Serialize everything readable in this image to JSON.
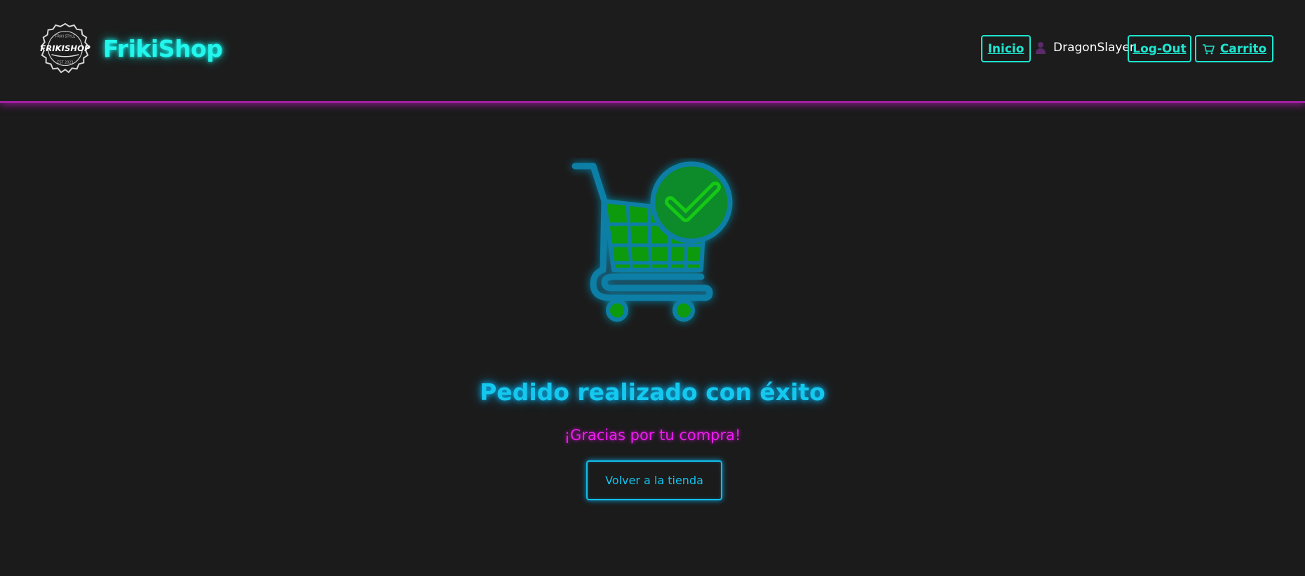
{
  "header": {
    "brand": "FrikiShop",
    "logo_text": "FRIKISHOP",
    "logo_small_top": "FRIKI STYLE",
    "logo_small_bottom": "EST 2023"
  },
  "nav": {
    "home_label": "Inicio",
    "username": "DragonSlayer",
    "logout_label": "Log-Out",
    "cart_label": "Carrito",
    "user_icon": "user-silhouette-icon",
    "cart_icon": "shopping-cart-icon"
  },
  "main": {
    "hero_icon": "cart-checkmark-icon",
    "title": "Pedido realizado con éxito",
    "subtitle": "¡Gracias por tu compra!",
    "back_button_label": "Volver a la tienda"
  },
  "colors": {
    "background": "#1b1b1b",
    "accent_cyan": "#1ee6d0",
    "title_blue": "#14c8ee",
    "subtitle_magenta": "#ee1cee",
    "divider_purple": "#a01fa0",
    "cart_green": "#10c810"
  }
}
